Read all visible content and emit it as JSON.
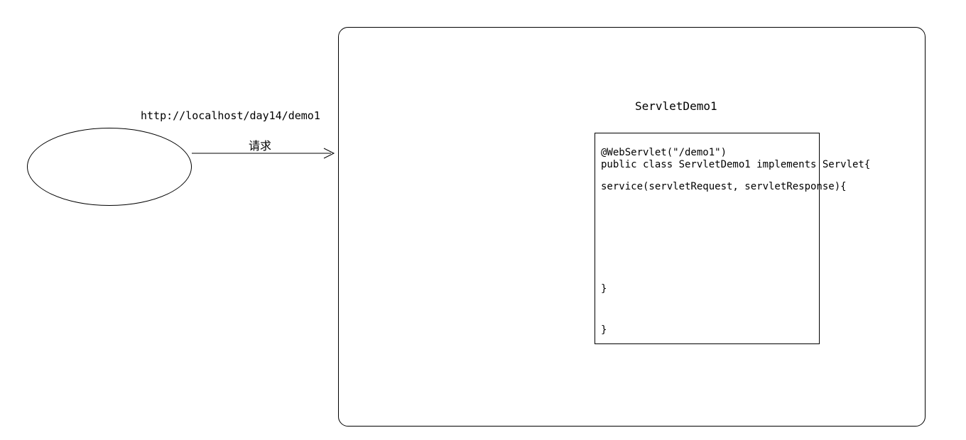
{
  "url": "http://localhost/day14/demo1",
  "request_label": "请求",
  "servlet_title": "ServletDemo1",
  "code": {
    "line1": "@WebServlet(\"/demo1\")",
    "line2": "public class ServletDemo1 implements Servlet{",
    "line3": "service(servletRequest, servletResponse){",
    "line4": "}",
    "line5": "}"
  }
}
